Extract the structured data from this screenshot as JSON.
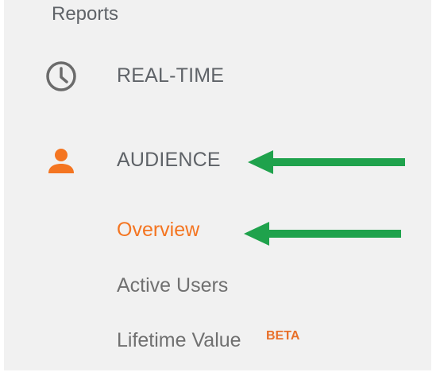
{
  "sidebar": {
    "section_title": "Reports",
    "items": [
      {
        "label": "REAL-TIME",
        "icon": "clock-icon"
      },
      {
        "label": "AUDIENCE",
        "icon": "person-icon",
        "active": true
      }
    ],
    "audience_subitems": [
      {
        "label": "Overview",
        "selected": true
      },
      {
        "label": "Active Users"
      },
      {
        "label": "Lifetime Value",
        "badge": "BETA"
      }
    ]
  },
  "colors": {
    "panel_bg": "#f1f1f1",
    "text_gray": "#5f6368",
    "accent_orange": "#f47521",
    "annotation_green": "#1fa24c"
  }
}
